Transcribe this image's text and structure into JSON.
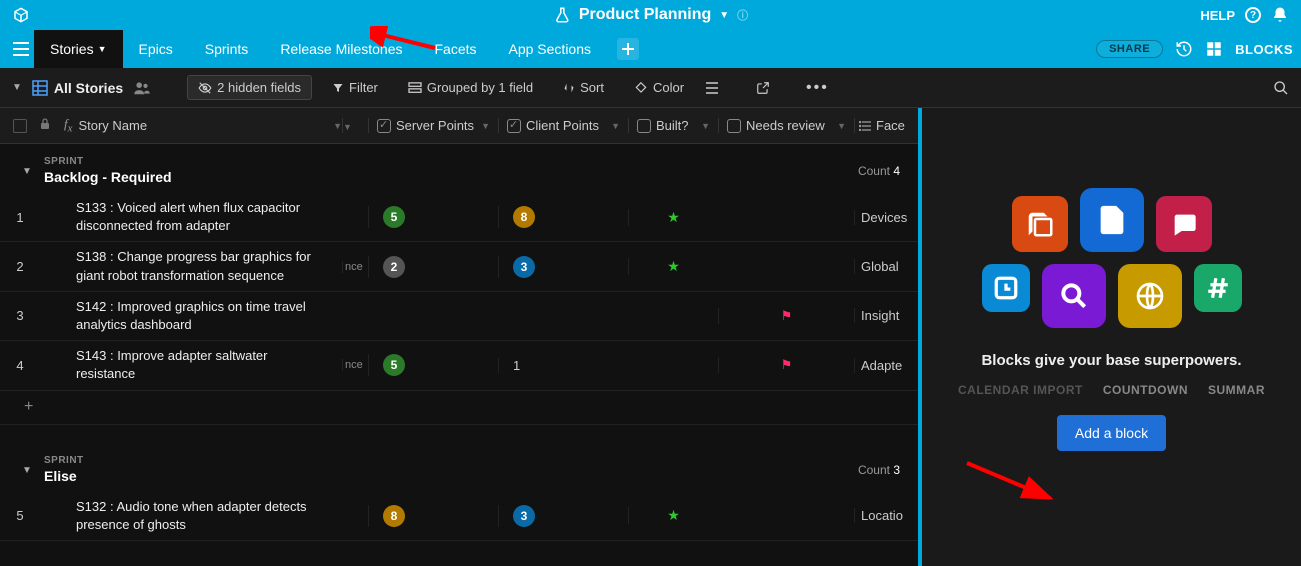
{
  "header": {
    "title": "Product Planning",
    "help_label": "HELP"
  },
  "tabs": {
    "items": [
      "Stories",
      "Epics",
      "Sprints",
      "Release Milestones",
      "Facets",
      "App Sections"
    ],
    "share_label": "SHARE",
    "blocks_label": "BLOCKS"
  },
  "viewbar": {
    "view_name": "All Stories",
    "hidden_fields": "2 hidden fields",
    "filter": "Filter",
    "grouped": "Grouped by 1 field",
    "sort": "Sort",
    "color": "Color"
  },
  "columns": {
    "name": "Story Name",
    "server": "Server Points",
    "client": "Client Points",
    "built": "Built?",
    "needs": "Needs review",
    "facet": "Face"
  },
  "groups": [
    {
      "sprint_label": "SPRINT",
      "name": "Backlog - Required",
      "count_label": "Count",
      "count": "4",
      "rows": [
        {
          "num": "1",
          "name": "S133 : Voiced alert when flux capacitor disconnected from adapter",
          "narrow": "",
          "server": "5",
          "server_color": "green",
          "client": "8",
          "client_color": "orange",
          "built": "star",
          "needs": "",
          "facet": "Devices"
        },
        {
          "num": "2",
          "name": "S138 : Change progress bar graphics for giant robot transformation sequence",
          "narrow": "nce",
          "server": "2",
          "server_color": "gray",
          "client": "3",
          "client_color": "blue",
          "built": "star",
          "needs": "",
          "facet": "Global"
        },
        {
          "num": "3",
          "name": "S142 : Improved graphics on time travel analytics dashboard",
          "narrow": "",
          "server": "",
          "server_color": "",
          "client": "",
          "client_color": "",
          "built": "",
          "needs": "flag",
          "facet": "Insight"
        },
        {
          "num": "4",
          "name": "S143 : Improve adapter saltwater resistance",
          "narrow": "nce",
          "server": "5",
          "server_color": "green",
          "client": "1",
          "client_color": "none",
          "built": "",
          "needs": "flag",
          "facet": "Adapte"
        }
      ]
    },
    {
      "sprint_label": "SPRINT",
      "name": "Elise",
      "count_label": "Count",
      "count": "3",
      "rows": [
        {
          "num": "5",
          "name": "S132 : Audio tone when adapter detects presence of ghosts",
          "narrow": "",
          "server": "8",
          "server_color": "orange",
          "client": "3",
          "client_color": "blue",
          "built": "star",
          "needs": "",
          "facet": "Locatio"
        }
      ]
    }
  ],
  "blocks_pane": {
    "tagline": "Blocks give your base superpowers.",
    "types": [
      "CALENDAR IMPORT",
      "COUNTDOWN",
      "SUMMAR"
    ],
    "add_button": "Add a block",
    "icon_colors": [
      "#d84a12",
      "#146ad4",
      "#c22048",
      "#0a8ad4",
      "#7a1ad4",
      "#c79a00",
      "#1aa86a"
    ]
  }
}
